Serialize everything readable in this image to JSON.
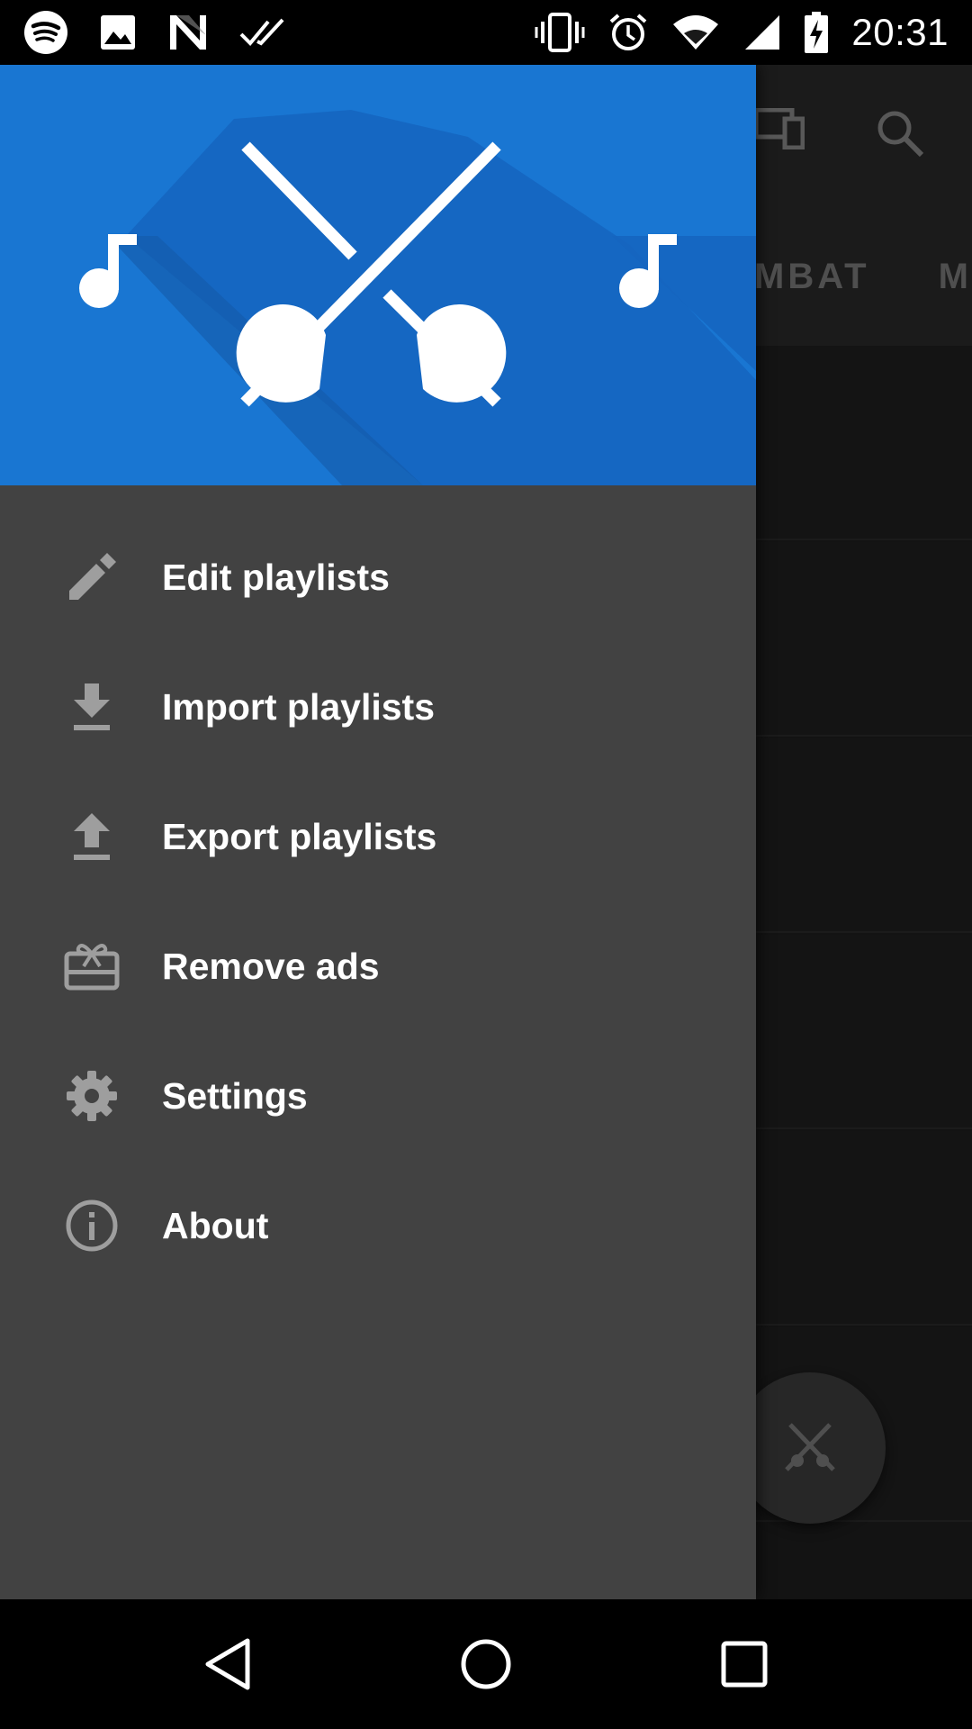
{
  "status_bar": {
    "time": "20:31",
    "left_icons": [
      "spotify-icon",
      "image-icon",
      "n-icon",
      "double-check-icon"
    ],
    "right_icons": [
      "vibrate-icon",
      "alarm-icon",
      "wifi-icon",
      "signal-icon",
      "battery-charging-icon"
    ]
  },
  "background_app": {
    "tabs": [
      "MBAT",
      "M"
    ],
    "toolbar_icons": [
      "cast-icon",
      "search-icon"
    ]
  },
  "drawer": {
    "header_logo": "fencing-swords-music-logo",
    "items": [
      {
        "label": "Edit playlists",
        "icon": "pencil-icon"
      },
      {
        "label": "Import playlists",
        "icon": "download-icon"
      },
      {
        "label": "Export playlists",
        "icon": "upload-icon"
      },
      {
        "label": "Remove ads",
        "icon": "gift-card-icon"
      },
      {
        "label": "Settings",
        "icon": "gear-icon"
      },
      {
        "label": "About",
        "icon": "info-icon"
      }
    ]
  },
  "nav_bar": {
    "buttons": [
      "back-icon",
      "home-icon",
      "recents-icon"
    ]
  },
  "colors": {
    "header_blue": "#1976d2",
    "drawer_bg": "#424242",
    "icon_grey": "#9e9e9e"
  }
}
